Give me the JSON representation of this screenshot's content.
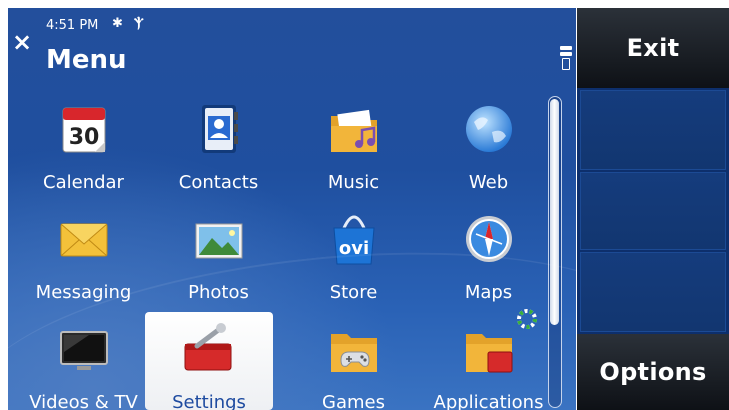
{
  "status": {
    "time": "4:51 PM",
    "bluetooth": "✱",
    "signal": "Ⲯ"
  },
  "header": {
    "close": "×",
    "title": "Menu"
  },
  "softkeys": {
    "top": "Exit",
    "bottom": "Options"
  },
  "calendar": {
    "date": "30"
  },
  "store": {
    "logo": "ovi"
  },
  "menu": {
    "items": [
      {
        "label": "Calendar",
        "icon": "calendar-icon"
      },
      {
        "label": "Contacts",
        "icon": "contacts-icon"
      },
      {
        "label": "Music",
        "icon": "music-folder-icon"
      },
      {
        "label": "Web",
        "icon": "globe-icon"
      },
      {
        "label": "Messaging",
        "icon": "envelope-icon"
      },
      {
        "label": "Photos",
        "icon": "photo-icon"
      },
      {
        "label": "Store",
        "icon": "ovi-store-icon"
      },
      {
        "label": "Maps",
        "icon": "compass-icon"
      },
      {
        "label": "Videos & TV",
        "icon": "tv-icon"
      },
      {
        "label": "Settings",
        "icon": "toolbox-icon"
      },
      {
        "label": "Games",
        "icon": "gamepad-folder-icon"
      },
      {
        "label": "Applications",
        "icon": "applications-folder-icon"
      }
    ],
    "selected": "Settings"
  },
  "colors": {
    "background": "#234f9c",
    "softkey": "#1a1e24",
    "selected_tile": "#ffffff",
    "selected_label": "#1e4ba0"
  }
}
